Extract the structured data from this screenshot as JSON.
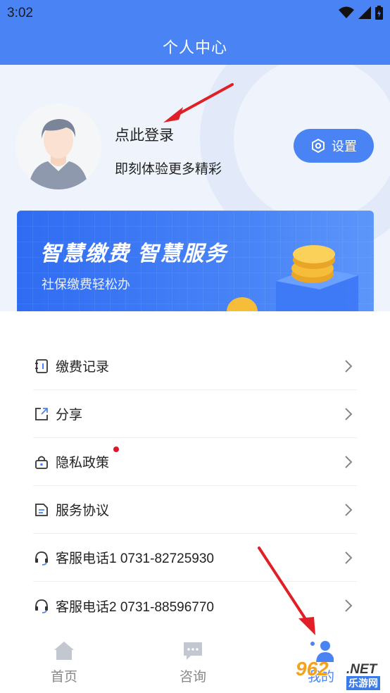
{
  "status_bar": {
    "time": "3:02"
  },
  "header": {
    "title": "个人中心"
  },
  "profile": {
    "login_title": "点此登录",
    "login_subtitle": "即刻体验更多精彩",
    "settings_label": "设置"
  },
  "banner": {
    "title": "智慧缴费  智慧服务",
    "subtitle": "社保缴费轻松办"
  },
  "menu": [
    {
      "label": "缴费记录",
      "icon": "record-icon"
    },
    {
      "label": "分享",
      "icon": "share-icon"
    },
    {
      "label": "隐私政策",
      "icon": "lock-icon",
      "badge": true
    },
    {
      "label": "服务协议",
      "icon": "document-icon"
    },
    {
      "label": "客服电话1 0731-82725930",
      "icon": "headset-icon"
    },
    {
      "label": "客服电话2 0731-88596770",
      "icon": "headset-icon"
    }
  ],
  "tabbar": {
    "home": "首页",
    "consult": "咨询",
    "mine": "我的"
  },
  "watermark": {
    "main": "962",
    "net": ".NET",
    "cn": "乐游网"
  },
  "colors": {
    "primary": "#4a84f4",
    "badge": "#e0152b",
    "arrow": "#e01f26"
  }
}
